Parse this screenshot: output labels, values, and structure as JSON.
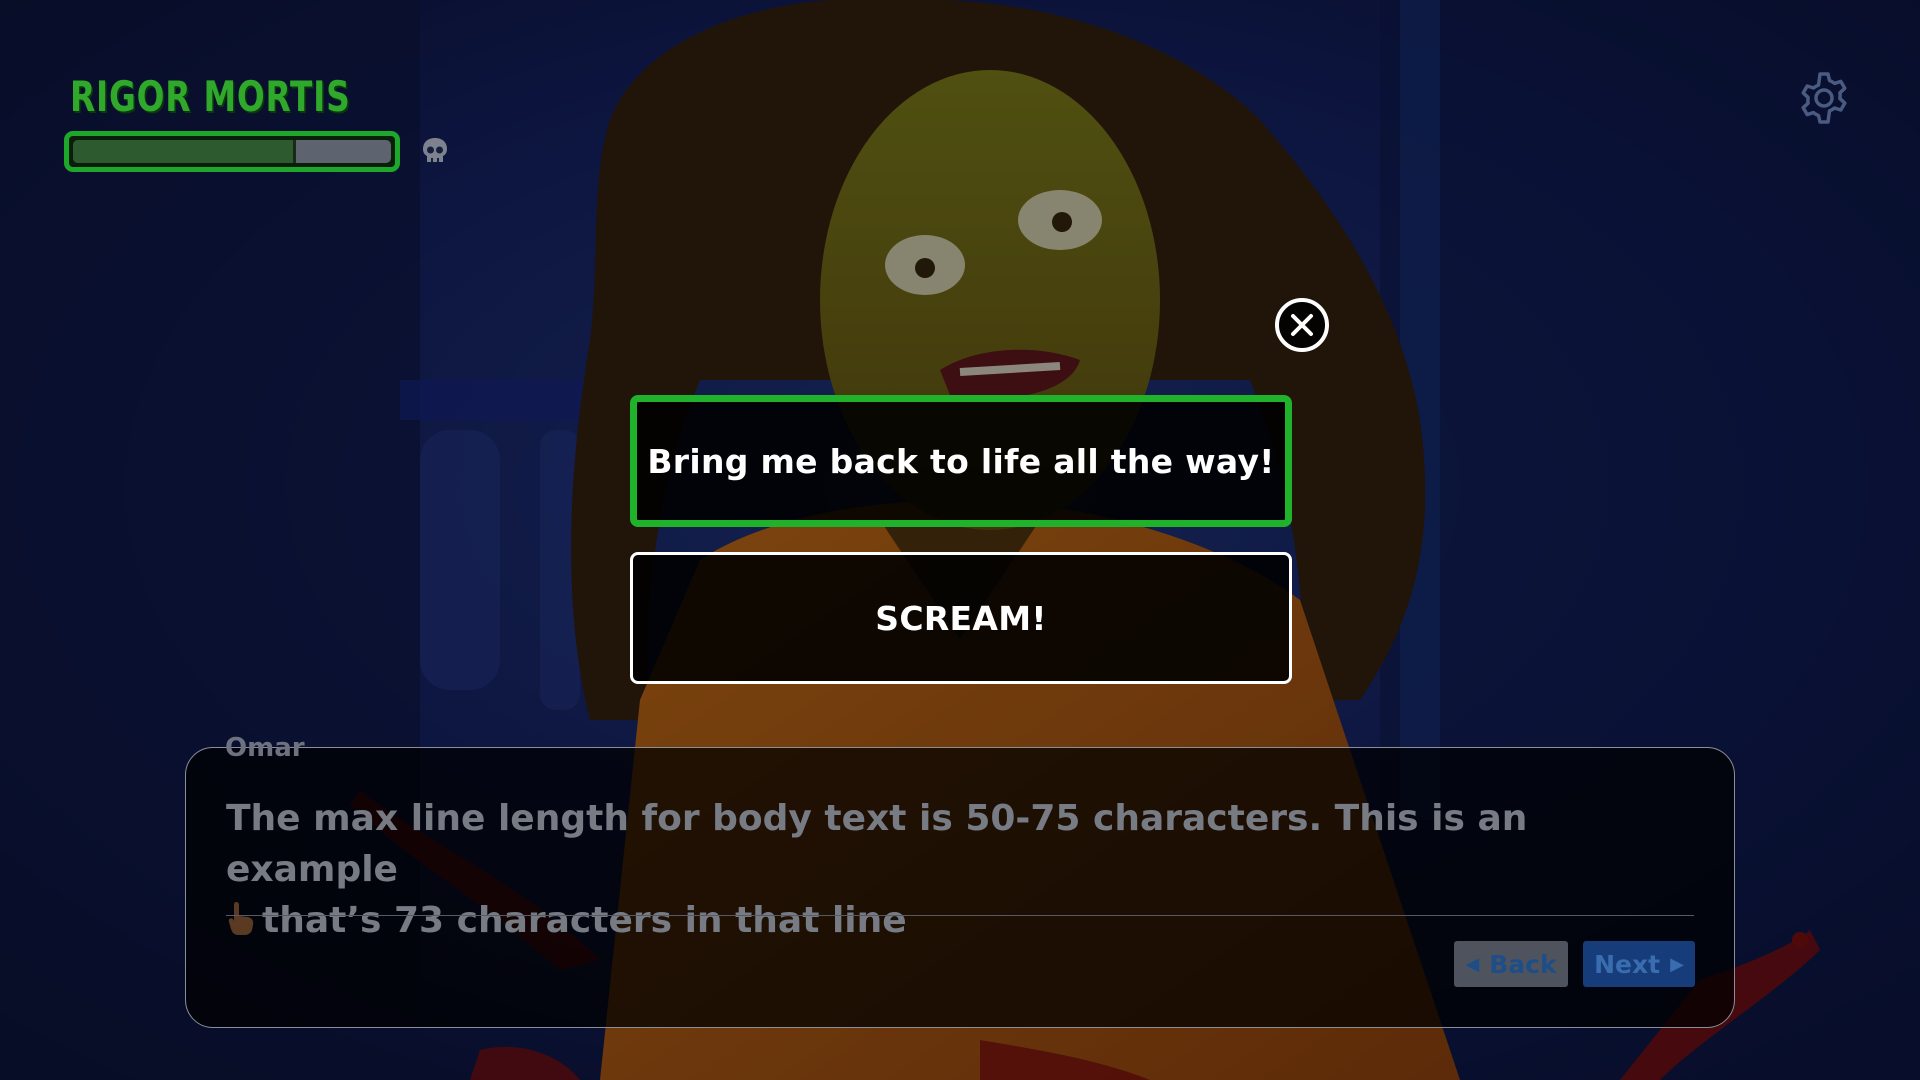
{
  "hud": {
    "meter_title": "RIGOR MORTIS",
    "meter_level": 0.7,
    "colors": {
      "meter_green": "#1ea82b",
      "meter_fill": "#2e5a30",
      "meter_empty": "#5d6470"
    },
    "meter_icon": "skull-icon",
    "settings_icon": "gear-icon"
  },
  "choices": {
    "close_icon": "close-icon",
    "options": [
      {
        "label": "Bring me back to life all the way!",
        "selected": true
      },
      {
        "label": "SCREAM!",
        "selected": false
      }
    ],
    "colors": {
      "selected_border": "#1fb22a",
      "default_border": "#ffffff"
    }
  },
  "dialogue": {
    "speaker": "Omar",
    "line1": "The max line length for body text is 50-75 characters. This is an example",
    "line2": "that’s 73 characters in that line",
    "pointer_icon": "pointing-finger-icon",
    "back_label": "Back",
    "next_label": "Next"
  }
}
